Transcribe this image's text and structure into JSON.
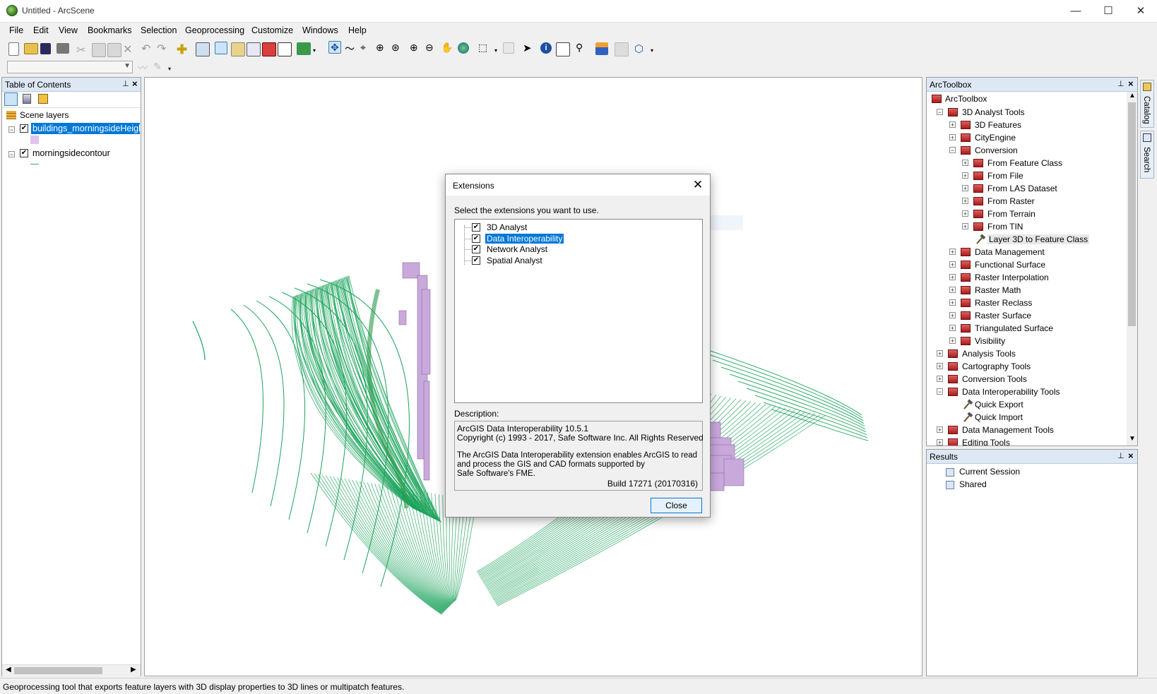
{
  "window": {
    "title": "Untitled - ArcScene",
    "minimize": "—",
    "maximize": "☐",
    "close": "✕"
  },
  "menu": [
    "File",
    "Edit",
    "View",
    "Bookmarks",
    "Selection",
    "Geoprocessing",
    "Customize",
    "Windows",
    "Help"
  ],
  "toc": {
    "title": "Table of Contents",
    "root": "Scene layers",
    "layers": [
      {
        "name": "buildings_morningsideHeigh",
        "checked": true,
        "selected": true,
        "swatch": "#e0c4f0"
      },
      {
        "name": "morningsidecontour",
        "checked": true,
        "selected": false,
        "swatch": "#2eb06a"
      }
    ]
  },
  "toolbox": {
    "title": "ArcToolbox",
    "root": "ArcToolbox",
    "items": [
      {
        "label": "3D Analyst Tools",
        "level": 1,
        "exp": "−",
        "icon": "toolbox"
      },
      {
        "label": "3D Features",
        "level": 2,
        "exp": "+",
        "icon": "toolset"
      },
      {
        "label": "CityEngine",
        "level": 2,
        "exp": "+",
        "icon": "toolset"
      },
      {
        "label": "Conversion",
        "level": 2,
        "exp": "−",
        "icon": "toolset"
      },
      {
        "label": "From Feature Class",
        "level": 3,
        "exp": "+",
        "icon": "toolset"
      },
      {
        "label": "From File",
        "level": 3,
        "exp": "+",
        "icon": "toolset"
      },
      {
        "label": "From LAS Dataset",
        "level": 3,
        "exp": "+",
        "icon": "toolset"
      },
      {
        "label": "From Raster",
        "level": 3,
        "exp": "+",
        "icon": "toolset"
      },
      {
        "label": "From Terrain",
        "level": 3,
        "exp": "+",
        "icon": "toolset"
      },
      {
        "label": "From TIN",
        "level": 3,
        "exp": "+",
        "icon": "toolset"
      },
      {
        "label": "Layer 3D to Feature Class",
        "level": 3,
        "exp": "",
        "icon": "tool",
        "highlight": true
      },
      {
        "label": "Data Management",
        "level": 2,
        "exp": "+",
        "icon": "toolset"
      },
      {
        "label": "Functional Surface",
        "level": 2,
        "exp": "+",
        "icon": "toolset"
      },
      {
        "label": "Raster Interpolation",
        "level": 2,
        "exp": "+",
        "icon": "toolset"
      },
      {
        "label": "Raster Math",
        "level": 2,
        "exp": "+",
        "icon": "toolset"
      },
      {
        "label": "Raster Reclass",
        "level": 2,
        "exp": "+",
        "icon": "toolset"
      },
      {
        "label": "Raster Surface",
        "level": 2,
        "exp": "+",
        "icon": "toolset"
      },
      {
        "label": "Triangulated Surface",
        "level": 2,
        "exp": "+",
        "icon": "toolset"
      },
      {
        "label": "Visibility",
        "level": 2,
        "exp": "+",
        "icon": "toolset"
      },
      {
        "label": "Analysis Tools",
        "level": 1,
        "exp": "+",
        "icon": "toolbox"
      },
      {
        "label": "Cartography Tools",
        "level": 1,
        "exp": "+",
        "icon": "toolbox"
      },
      {
        "label": "Conversion Tools",
        "level": 1,
        "exp": "+",
        "icon": "toolbox"
      },
      {
        "label": "Data Interoperability Tools",
        "level": 1,
        "exp": "−",
        "icon": "toolbox"
      },
      {
        "label": "Quick Export",
        "level": 2,
        "exp": "",
        "icon": "tool"
      },
      {
        "label": "Quick Import",
        "level": 2,
        "exp": "",
        "icon": "tool"
      },
      {
        "label": "Data Management Tools",
        "level": 1,
        "exp": "+",
        "icon": "toolbox"
      },
      {
        "label": "Editing Tools",
        "level": 1,
        "exp": "+",
        "icon": "toolbox"
      }
    ]
  },
  "results": {
    "title": "Results",
    "items": [
      "Current Session",
      "Shared"
    ]
  },
  "sidetabs": [
    "Catalog",
    "Search"
  ],
  "dialog": {
    "title": "Extensions",
    "prompt": "Select the extensions you want to use.",
    "extensions": [
      {
        "label": "3D Analyst",
        "checked": true,
        "selected": false
      },
      {
        "label": "Data Interoperability",
        "checked": true,
        "selected": true
      },
      {
        "label": "Network Analyst",
        "checked": true,
        "selected": false
      },
      {
        "label": "Spatial Analyst",
        "checked": true,
        "selected": false
      }
    ],
    "description_label": "Description:",
    "description": {
      "line1": "ArcGIS Data Interoperability 10.5.1",
      "line2": "Copyright (c) 1993 - 2017, Safe Software Inc. All Rights Reserved",
      "line3": "The ArcGIS Data Interoperability extension enables ArcGIS to read",
      "line4": "and process the GIS and CAD formats supported by",
      "line5": "Safe Software's FME.",
      "build": "Build 17271 (20170316)"
    },
    "close_label": "Close"
  },
  "ghost_text": "Window Snip",
  "status": "Geoprocessing tool that exports feature layers with 3D display properties to 3D lines or multipatch features.",
  "colors": {
    "contour": "#1aa35a",
    "building": "#c9a9dc",
    "selection": "#0078d7",
    "panel_header": "#dde8f4"
  }
}
